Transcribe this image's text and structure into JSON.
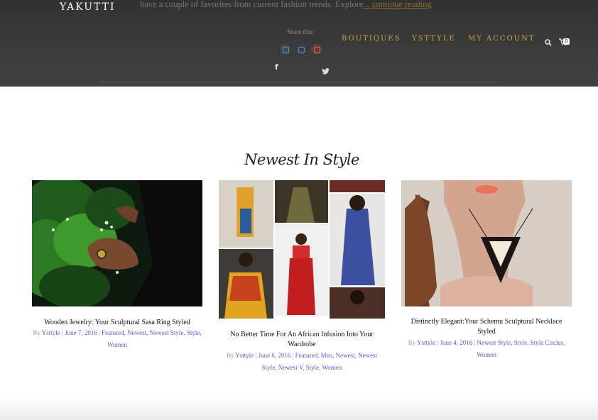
{
  "header": {
    "logo": "YAKUTTI",
    "excerpt_text": "have a couple of favorites from current fashion trends. Explore",
    "excerpt_more": "... continue reading",
    "share_label": "Share this:",
    "share_buttons": [
      {
        "icon": "share-icon",
        "color": "#3a4c57"
      },
      {
        "icon": "share-icon",
        "color": "#344254"
      },
      {
        "icon": "share-icon",
        "color": "#6a3c35"
      }
    ],
    "facebook_glyph": "f",
    "nav": [
      "BOUTIQUES",
      "YSTTYLE",
      "MY ACCOUNT"
    ],
    "cart_count": "0",
    "accent_color": "#c9a24a"
  },
  "section": {
    "title": "Newest In Style"
  },
  "posts": [
    {
      "title": "Wooden Jewelry: Your Sculptural Sasa Ring Styled",
      "by": "By",
      "author": "Ysttyle",
      "sep1": "|",
      "date": "June 7, 2016",
      "sep2": "|",
      "categories": "Featured, Newest, Newest Style, Style, Women",
      "image": "hand-ring-leaves-photo"
    },
    {
      "title": "No Better Time For An African Infusion Into Your Wardrobe",
      "by": "By",
      "author": "Ysttyle",
      "sep1": "|",
      "date": "June 6, 2016",
      "sep2": "|",
      "categories": "Featured, Men, Newest, Newest Style, Newest V, Style, Women",
      "image": "african-fashion-collage-photo"
    },
    {
      "title": "Distinctly Elegant:Your Schemu Sculptural Necklace Styled",
      "by": "By",
      "author": "Ysttyle",
      "sep1": "|",
      "date": "June 4, 2016",
      "sep2": "|",
      "categories": "Newest Style, Style, Style Circles, Women",
      "image": "necklace-portrait-photo"
    }
  ]
}
